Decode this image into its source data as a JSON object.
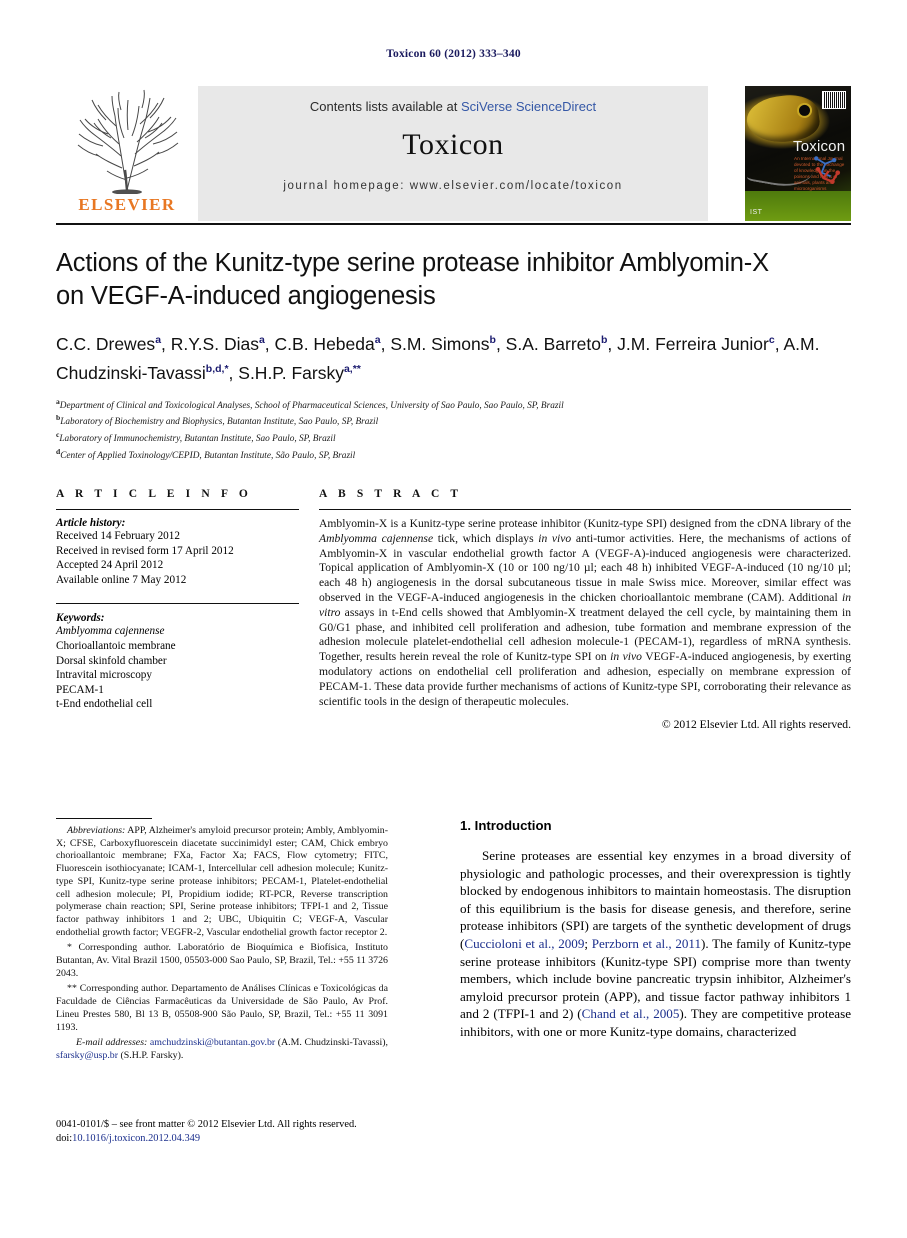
{
  "running_head": "Toxicon 60 (2012) 333–340",
  "masthead": {
    "contents_prefix": "Contents lists available at ",
    "contents_link": "SciVerse ScienceDirect",
    "journal_title": "Toxicon",
    "homepage": "journal homepage: www.elsevier.com/locate/toxicon",
    "publisher_name": "ELSEVIER",
    "cover_title": "Toxicon",
    "cover_subtitle": "An International Journal devoted to the exchange of knowledge on the poisons and toxins of animals, plants and microorganisms",
    "cover_tag": "IST"
  },
  "article": {
    "title_line1": "Actions of the Kunitz-type serine protease inhibitor Amblyomin-X",
    "title_line2": "on VEGF-A-induced angiogenesis",
    "authors": [
      {
        "name": "C.C. Drewes",
        "sup": "a",
        "sep": ", "
      },
      {
        "name": "R.Y.S. Dias",
        "sup": "a",
        "sep": ", "
      },
      {
        "name": "C.B. Hebeda",
        "sup": "a",
        "sep": ", "
      },
      {
        "name": "S.M. Simons",
        "sup": "b",
        "sep": ", "
      },
      {
        "name": "S.A. Barreto",
        "sup": "b",
        "sep": ", "
      },
      {
        "name": "J.M. Ferreira Junior",
        "sup": "c",
        "sep": ", "
      },
      {
        "name": "A.M. Chudzinski-Tavassi",
        "sup": "b,d,*",
        "sep": ", "
      },
      {
        "name": "S.H.P. Farsky",
        "sup": "a,**",
        "sep": ""
      }
    ],
    "affiliations": [
      {
        "mark": "a",
        "text": "Department of Clinical and Toxicological Analyses, School of Pharmaceutical Sciences, University of Sao Paulo, Sao Paulo, SP, Brazil"
      },
      {
        "mark": "b",
        "text": "Laboratory of Biochemistry and Biophysics, Butantan Institute, Sao Paulo, SP, Brazil"
      },
      {
        "mark": "c",
        "text": "Laboratory of Immunochemistry, Butantan Institute, Sao Paulo, SP, Brazil"
      },
      {
        "mark": "d",
        "text": "Center of Applied Toxinology/CEPID, Butantan Institute, São Paulo, SP, Brazil"
      }
    ]
  },
  "article_info": {
    "heading": "A R T I C L E  I N F O",
    "history_label": "Article history:",
    "history": [
      "Received 14 February 2012",
      "Received in revised form 17 April 2012",
      "Accepted 24 April 2012",
      "Available online 7 May 2012"
    ],
    "keywords_label": "Keywords:",
    "keywords": [
      "Amblyomma cajennense",
      "Chorioallantoic membrane",
      "Dorsal skinfold chamber",
      "Intravital microscopy",
      "PECAM-1",
      "t-End endothelial cell"
    ]
  },
  "abstract": {
    "heading": "A B S T R A C T",
    "paragraph_html": "Amblyomin-X is a Kunitz-type serine protease inhibitor (Kunitz-type SPI) designed from the cDNA library of the <span class=\"it\">Amblyomma cajennense</span> tick, which displays <span class=\"it\">in vivo</span> anti-tumor activities. Here, the mechanisms of actions of Amblyomin-X in vascular endothelial growth factor A (VEGF-A)-induced angiogenesis were characterized. Topical application of Amblyomin-X (10 or 100 ng/10 µl; each 48 h) inhibited VEGF-A-induced (10 ng/10 µl; each 48 h) angiogenesis in the dorsal subcutaneous tissue in male Swiss mice. Moreover, similar effect was observed in the VEGF-A-induced angiogenesis in the chicken chorioallantoic membrane (CAM). Additional <span class=\"it\">in vitro</span> assays in t-End cells showed that Amblyomin-X treatment delayed the cell cycle, by maintaining them in G0/G1 phase, and inhibited cell proliferation and adhesion, tube formation and membrane expression of the adhesion molecule platelet-endothelial cell adhesion molecule-1 (PECAM-1), regardless of mRNA synthesis. Together, results herein reveal the role of Kunitz-type SPI on <span class=\"it\">in vivo</span> VEGF-A-induced angiogenesis, by exerting modulatory actions on endothelial cell proliferation and adhesion, especially on membrane expression of PECAM-1. These data provide further mechanisms of actions of Kunitz-type SPI, corroborating their relevance as scientific tools in the design of therapeutic molecules.",
    "copyright": "© 2012 Elsevier Ltd. All rights reserved."
  },
  "footnotes": {
    "abbreviations_html": "<span class=\"it\">Abbreviations:</span> APP, Alzheimer's amyloid precursor protein; Ambly, Amblyomin-X; CFSE, Carboxyfluorescein diacetate succinimidyl ester; CAM, Chick embryo chorioallantoic membrane; FXa, Factor Xa; FACS, Flow cytometry; FITC, Fluorescein isothiocyanate; ICAM-1, Intercellular cell adhesion molecule; Kunitz-type SPI, Kunitz-type serine protease inhibitors; PECAM-1, Platelet-endothelial cell adhesion molecule; PI, Propidium iodide; RT-PCR, Reverse transcription polymerase chain reaction; SPI, Serine protease inhibitors; TFPI-1 and 2, Tissue factor pathway inhibitors 1 and 2; UBC, Ubiquitin C; VEGF-A, Vascular endothelial growth factor; VEGFR-2, Vascular endothelial growth factor receptor 2.",
    "corresponding1_html": "* Corresponding author. Laboratório de Bioquímica e Biofísica, Instituto Butantan, Av. Vital Brazil 1500, 05503-000 Sao Paulo, SP, Brazil, Tel.: +55 11 3726 2043.",
    "corresponding2_html": "** Corresponding author. Departamento de Análises Clínicas e Toxicológicas da Faculdade de Ciências Farmacêuticas da Universidade de São Paulo, Av Prof. Lineu Prestes 580, Bl 13 B, 05508-900 São Paulo, SP, Brazil, Tel.: +55 11 3091 1193.",
    "emails_html": "<span class=\"it\">E-mail addresses:</span> <span class=\"link\">amchudzinski@butantan.gov.br</span> (A.M. Chudzinski-Tavassi), <span class=\"link\">sfarsky@usp.br</span> (S.H.P. Farsky)."
  },
  "introduction": {
    "heading": "1. Introduction",
    "paragraph_html": "Serine proteases are essential key enzymes in a broad diversity of physiologic and pathologic processes, and their overexpression is tightly blocked by endogenous inhibitors to maintain homeostasis. The disruption of this equilibrium is the basis for disease genesis, and therefore, serine protease inhibitors (SPI) are targets of the synthetic development of drugs (<span class=\"cite\">Cuccioloni et al., 2009</span>; <span class=\"cite\">Perzborn et al., 2011</span>). The family of Kunitz-type serine protease inhibitors (Kunitz-type SPI) comprise more than twenty members, which include bovine pancreatic trypsin inhibitor, Alzheimer's amyloid precursor protein (APP), and tissue factor pathway inhibitors 1 and 2 (TFPI-1 and 2) (<span class=\"cite\">Chand et al., 2005</span>). They are competitive protease inhibitors, with one or more Kunitz-type domains, characterized"
  },
  "footer": {
    "line1": "0041-0101/$ – see front matter © 2012 Elsevier Ltd. All rights reserved.",
    "doi_prefix": "doi:",
    "doi_link": "10.1016/j.toxicon.2012.04.349"
  },
  "colors": {
    "running_head": "#1a1a5e",
    "link": "#3457a6",
    "cite": "#1a2e8c",
    "elsevier_orange": "#e87722",
    "masthead_bg": "#e8e8e8"
  }
}
